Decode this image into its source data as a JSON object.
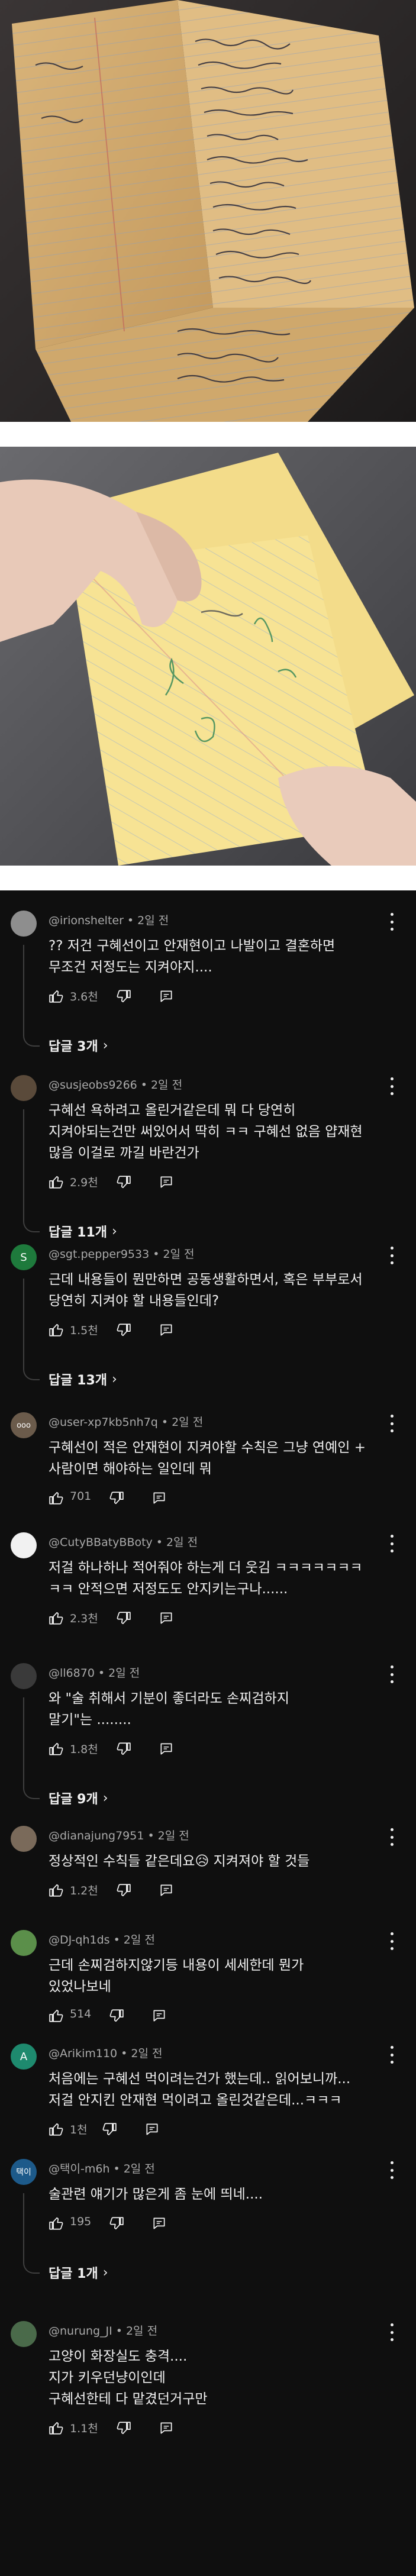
{
  "photos": [
    {
      "name": "folded-note-photo",
      "desc_visible": true
    },
    {
      "name": "hand-holding-note-photo",
      "desc_visible": true
    }
  ],
  "comments": [
    {
      "handle": "@irionshelter",
      "time": "2일 전",
      "text": "?? 저건 구혜선이고 안재현이고 나발이고 결혼하면\n무조건 저정도는 지켜야지....",
      "likes": "3.6천",
      "replies": "답글 3개",
      "avatar_color": "#8e8e8e",
      "avatar_text": ""
    },
    {
      "handle": "@susjeobs9266",
      "time": "2일 전",
      "text": "구혜선 욕하려고 올린거같은데 뭐 다 당연히\n지켜야되는건만 써있어서 딱히 ㅋㅋ 구혜선 없음 얍재현\n많음 이걸로 까길 바란건가",
      "likes": "2.9천",
      "replies": "답글 11개",
      "avatar_color": "#5a4a3a",
      "avatar_text": ""
    },
    {
      "handle": "@sgt.pepper9533",
      "time": "2일 전",
      "text": "근데 내용들이 뭔만하면 공동생활하면서, 혹은 부부로서\n당연히 지켜야 할 내용들인데?",
      "likes": "1.5천",
      "replies": "답글 13개",
      "avatar_color": "#1e7a3c",
      "avatar_text": "S"
    },
    {
      "handle": "@user-xp7kb5nh7q",
      "time": "2일 전",
      "text": "구혜선이 적은 안재현이 지켜야할 수칙은 그냥 연예인 +\n사람이면 해야하는 일인데 뭐",
      "likes": "701",
      "replies": "",
      "avatar_color": "#6b5b4b",
      "avatar_text": "ooo"
    },
    {
      "handle": "@CutyBBatyBBoty",
      "time": "2일 전",
      "text": "저걸 하나하나 적어줘야 하는게 더 웃김 ㅋㅋㅋㅋㅋㅋㅋ\nㅋㅋ 안적으면 저정도도 안지키는구나......",
      "likes": "2.3천",
      "replies": "",
      "avatar_color": "#f1f1f1",
      "avatar_text": ""
    },
    {
      "handle": "@ll6870",
      "time": "2일 전",
      "text": "와 \"술 취해서 기분이 좋더라도 손찌검하지\n말기\"는 ........",
      "likes": "1.8천",
      "replies": "답글 9개",
      "avatar_color": "#3a3a3a",
      "avatar_text": ""
    },
    {
      "handle": "@dianajung7951",
      "time": "2일 전",
      "text": "정상적인 수칙들 같은데요😥  지켜져야 할 것들",
      "likes": "1.2천",
      "replies": "",
      "avatar_color": "#7a6a5a",
      "avatar_text": ""
    },
    {
      "handle": "@DJ-qh1ds",
      "time": "2일 전",
      "text": "근데 손찌검하지않기등 내용이 세세한데 뭔가\n있었나보네",
      "likes": "514",
      "replies": "",
      "avatar_color": "#5b8f4a",
      "avatar_text": ""
    },
    {
      "handle": "@Arikim110",
      "time": "2일 전",
      "text": "처음에는 구혜선 먹이려는건가 했는데.. 읽어보니까...\n저걸 안지킨 안재현 먹이려고 올린것같은데...ㅋㅋㅋ",
      "likes": "1천",
      "replies": "",
      "avatar_color": "#1e8a6e",
      "avatar_text": "A"
    },
    {
      "handle": "@택이-m6h",
      "time": "2일 전",
      "text": "술관련 얘기가 많은게 좀 눈에 띄네....",
      "likes": "195",
      "replies": "답글 1개",
      "avatar_color": "#1d5a8a",
      "avatar_text": "택이"
    },
    {
      "handle": "@nurung_JI",
      "time": "2일 전",
      "text": "고양이 화장실도 충격....\n지가 키우던냥이인데\n구혜선한테 다 맡겼던거구만",
      "likes": "1.1천",
      "replies": "",
      "avatar_color": "#4a6a4a",
      "avatar_text": ""
    }
  ]
}
